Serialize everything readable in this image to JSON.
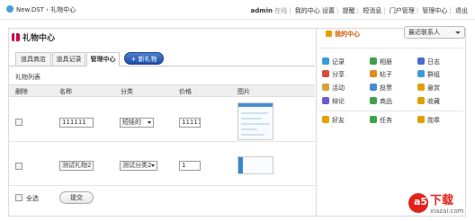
{
  "topbar": {
    "brand": "New.DST",
    "breadcrumb_sep": "›",
    "breadcrumb_current": "礼物中心",
    "username": "admin",
    "online": "在线",
    "links": [
      "我的中心",
      "设置",
      "提醒",
      "短消息",
      "门户管理",
      "管理中心",
      "退出"
    ]
  },
  "page": {
    "title": "礼物中心",
    "tabs": [
      "道具商店",
      "道具记录",
      "管理中心"
    ],
    "active_tab": "管理中心",
    "new_gift_button": "+ 新礼物",
    "list_label": "礼物列表",
    "columns": [
      "删除",
      "名称",
      "分类",
      "价格",
      "图片"
    ],
    "rows": [
      {
        "name": "111111",
        "category": "短娃的",
        "price": "111111"
      },
      {
        "name": "测试礼物2",
        "category": "测试分类2",
        "price": "1"
      }
    ],
    "select_all": "全选",
    "submit": "提交"
  },
  "sidebar": {
    "my_center": "我的中心",
    "contacts_select": "最近联系人",
    "items": [
      {
        "label": "记录",
        "icon": "record-icon",
        "color": "#3a9bd9"
      },
      {
        "label": "相册",
        "icon": "album-icon",
        "color": "#3aa34a"
      },
      {
        "label": "日志",
        "icon": "blog-icon",
        "color": "#4a6fd0"
      },
      {
        "label": "分享",
        "icon": "share-icon",
        "color": "#d94a3a"
      },
      {
        "label": "帖子",
        "icon": "post-icon",
        "color": "#e08a1e"
      },
      {
        "label": "群组",
        "icon": "group-icon",
        "color": "#3a9bd9"
      },
      {
        "label": "活动",
        "icon": "event-icon",
        "color": "#d9a13a"
      },
      {
        "label": "投票",
        "icon": "vote-icon",
        "color": "#4a8bd0"
      },
      {
        "label": "悬赏",
        "icon": "reward-icon",
        "color": "#e0a000"
      },
      {
        "label": "辩论",
        "icon": "debate-icon",
        "color": "#6a5acd"
      },
      {
        "label": "商品",
        "icon": "goods-icon",
        "color": "#3aa34a"
      },
      {
        "label": "收藏",
        "icon": "favorite-icon",
        "color": "#e0a000"
      },
      {
        "label": "好友",
        "icon": "friends-icon",
        "color": "#e0a000"
      },
      {
        "label": "任务",
        "icon": "task-icon",
        "color": "#3aa34a"
      },
      {
        "label": "勋章",
        "icon": "medal-icon",
        "color": "#e0a000"
      }
    ]
  },
  "watermark": {
    "brand": "下载",
    "url": "xiazai.com",
    "badge": "a5"
  }
}
